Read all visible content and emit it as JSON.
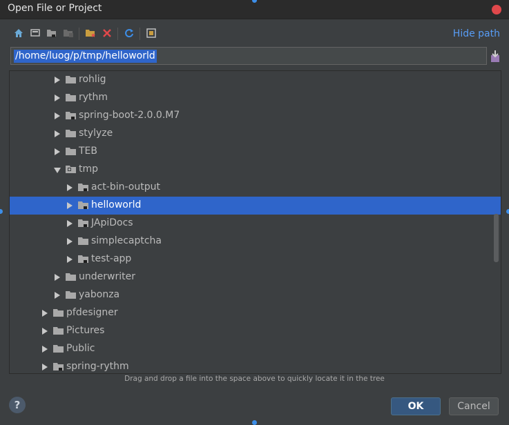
{
  "window": {
    "title": "Open File or Project"
  },
  "toolbar": {
    "buttons": [
      "home-icon",
      "desktop-icon",
      "project-folder-icon",
      "module-folder-icon",
      "new-folder-icon",
      "delete-icon",
      "refresh-icon",
      "show-hidden-icon"
    ],
    "hide_path_label": "Hide path"
  },
  "path": {
    "value": "/home/luog/p/tmp/helloworld"
  },
  "tree": {
    "rows": [
      {
        "label": "rohlig",
        "expanded": false
      },
      {
        "label": "rythm",
        "expanded": false
      },
      {
        "label": "spring-boot-2.0.0.M7",
        "expanded": false
      },
      {
        "label": "stylyze",
        "expanded": false
      },
      {
        "label": "TEB",
        "expanded": false
      },
      {
        "label": "tmp",
        "expanded": true
      },
      {
        "label": "act-bin-output",
        "expanded": false
      },
      {
        "label": "helloworld",
        "expanded": false,
        "selected": true
      },
      {
        "label": "JApiDocs",
        "expanded": false
      },
      {
        "label": "simplecaptcha",
        "expanded": false
      },
      {
        "label": "test-app",
        "expanded": false
      },
      {
        "label": "underwriter",
        "expanded": false
      },
      {
        "label": "yabonza",
        "expanded": false
      },
      {
        "label": "pfdesigner",
        "expanded": false
      },
      {
        "label": "Pictures",
        "expanded": false
      },
      {
        "label": "Public",
        "expanded": false
      },
      {
        "label": "spring-rythm",
        "expanded": false
      }
    ]
  },
  "hint": "Drag and drop a file into the space above to quickly locate it in the tree",
  "footer": {
    "help_label": "?",
    "ok_label": "OK",
    "cancel_label": "Cancel"
  },
  "colors": {
    "accent": "#2f65ca",
    "link": "#589df6",
    "background": "#3c3f41",
    "close": "#e0484b"
  }
}
